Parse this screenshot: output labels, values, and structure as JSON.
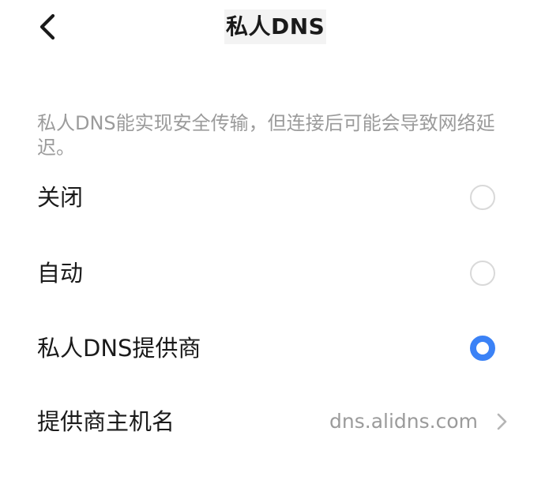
{
  "header": {
    "title": "私人DNS",
    "back_icon": "back-chevron-icon"
  },
  "description": "私人DNS能实现安全传输，但连接后可能会导致网络延迟。",
  "options": [
    {
      "label": "关闭",
      "selected": false
    },
    {
      "label": "自动",
      "selected": false
    },
    {
      "label": "私人DNS提供商",
      "selected": true
    }
  ],
  "provider_host": {
    "label": "提供商主机名",
    "value": "dns.alidns.com",
    "icon": "chevron-right-icon"
  },
  "colors": {
    "accent": "#3b82f6",
    "secondary_text": "#9b9b9b",
    "radio_border": "#d9d9d9"
  }
}
